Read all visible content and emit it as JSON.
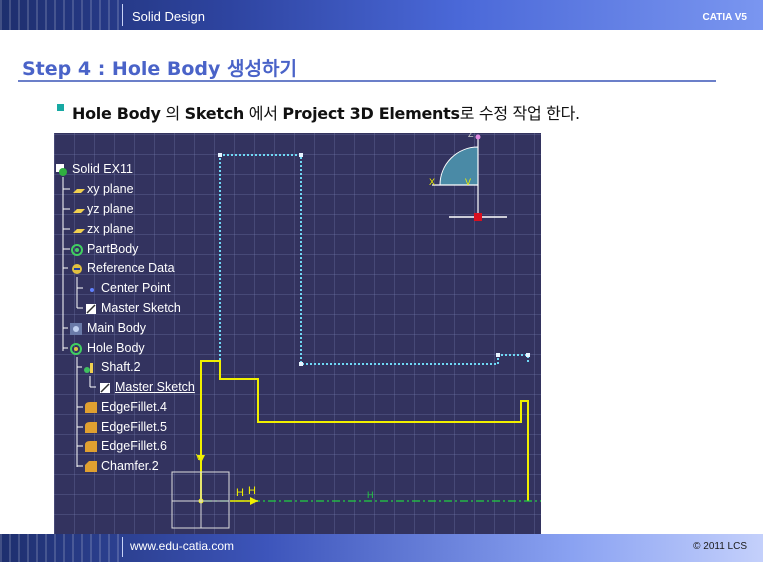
{
  "header": {
    "title": "Solid Design",
    "product": "CATIA V5"
  },
  "slide": {
    "title": "Step 4 : Hole Body 생성하기",
    "bullet": {
      "b1": "Hole Body",
      "t1": " 의 ",
      "b2": "Sketch",
      "t2": " 에서 ",
      "b3": "Project 3D Elements",
      "t3": "로 수정 작업 한다."
    }
  },
  "tree": {
    "items": [
      {
        "label": "Solid EX11",
        "icon": "part-icon"
      },
      {
        "label": "xy plane",
        "icon": "plane-icon"
      },
      {
        "label": "yz plane",
        "icon": "plane-icon"
      },
      {
        "label": "zx plane",
        "icon": "plane-icon"
      },
      {
        "label": "PartBody",
        "icon": "body-icon"
      },
      {
        "label": "Reference Data",
        "icon": "geoset-icon"
      },
      {
        "label": "Center Point",
        "icon": "point-icon"
      },
      {
        "label": "Master Sketch",
        "icon": "sketch-icon"
      },
      {
        "label": "Main Body",
        "icon": "body-icon"
      },
      {
        "label": "Hole Body",
        "icon": "body-icon"
      },
      {
        "label": "Shaft.2",
        "icon": "shaft-icon"
      },
      {
        "label": "Master Sketch",
        "icon": "sketch-icon"
      },
      {
        "label": "EdgeFillet.4",
        "icon": "fillet-icon"
      },
      {
        "label": "EdgeFillet.5",
        "icon": "fillet-icon"
      },
      {
        "label": "EdgeFillet.6",
        "icon": "fillet-icon"
      },
      {
        "label": "Chamfer.2",
        "icon": "chamfer-icon"
      }
    ]
  },
  "viewport": {
    "axis_labels": {
      "h1": "H",
      "h2": "H",
      "h3": "H",
      "v": "V",
      "z": "Z",
      "x": "X",
      "y": "V"
    }
  },
  "footer": {
    "url": "www.edu-catia.com",
    "copyright": "© 2011 LCS"
  },
  "colors": {
    "header_dark": "#1e2f6e",
    "title_blue": "#4a63c8",
    "viewport_bg": "#33335f",
    "sketch_yellow": "#f0f000",
    "projection_cyan": "#6fd8f5",
    "axis_green": "#20d040"
  }
}
